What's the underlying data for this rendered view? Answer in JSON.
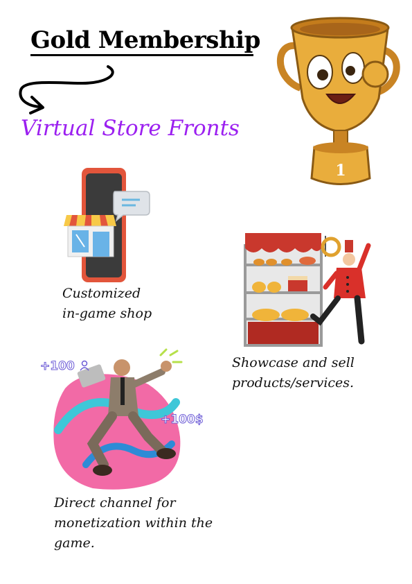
{
  "header": {
    "title": "Gold Membership",
    "subtitle": "Virtual Store Fronts"
  },
  "features": [
    {
      "line1": "Customized",
      "line2": "in-game shop",
      "icon": "phone-shop-icon"
    },
    {
      "line1": "Showcase and sell",
      "line2": "products/services.",
      "icon": "bakery-chef-icon"
    },
    {
      "line1": "Direct channel for",
      "line2": "monetization within the",
      "line3": "game.",
      "icon": "businessman-jump-icon"
    }
  ],
  "badges": {
    "users": "+100",
    "money": "+100$"
  },
  "colors": {
    "accent": "#9b1ff0",
    "gold": "#e0a12e",
    "red": "#d9302a",
    "pink": "#f26aa6"
  }
}
